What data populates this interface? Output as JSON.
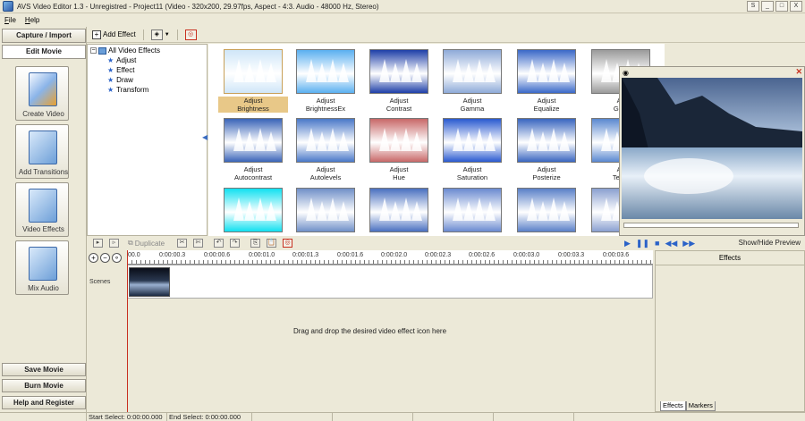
{
  "window": {
    "title": "AVS Video Editor 1.3 - Unregistred - Project11 (Video - 320x200, 29.97fps, Aspect - 4:3. Audio - 48000 Hz, Stereo)",
    "buttons": [
      "S",
      "_",
      "□",
      "X"
    ]
  },
  "menu": [
    {
      "label": "File",
      "accel": "F",
      "rest": "ile"
    },
    {
      "label": "Help",
      "accel": "H",
      "rest": "elp"
    }
  ],
  "left_panel": {
    "capture_import": "Capture / Import",
    "edit_movie": "Edit Movie",
    "tools": [
      {
        "label": "Create Video",
        "icon": "film-folder-icon"
      },
      {
        "label": "Add Transitions",
        "icon": "transitions-icon"
      },
      {
        "label": "Video Effects",
        "icon": "effects-star-icon"
      },
      {
        "label": "Mix Audio",
        "icon": "audio-waveform-icon"
      }
    ],
    "save_movie": "Save Movie",
    "burn_movie": "Burn Movie",
    "help_register": "Help and Register"
  },
  "toolbar": {
    "add_effect": "Add Effect"
  },
  "tree": {
    "root": "All Video Effects",
    "items": [
      "Adjust",
      "Effect",
      "Draw",
      "Transform"
    ]
  },
  "effects": [
    {
      "line1": "Adjust",
      "line2": "Brightness",
      "bg": "#cfe6f8",
      "sel": true
    },
    {
      "line1": "Adjust",
      "line2": "BrightnessEx",
      "bg": "#5ab0f0"
    },
    {
      "line1": "Adjust",
      "line2": "Contrast",
      "bg": "#1e3fa8"
    },
    {
      "line1": "Adjust",
      "line2": "Gamma",
      "bg": "#8eaad8"
    },
    {
      "line1": "Adjust",
      "line2": "Equalize",
      "bg": "#3a68c8"
    },
    {
      "line1": "Ac",
      "line2": "Gray",
      "bg": "#9a9a9a"
    },
    {
      "line1": "Adjust",
      "line2": "Autocontrast",
      "bg": "#3a64b8"
    },
    {
      "line1": "Adjust",
      "line2": "Autolevels",
      "bg": "#4a78c8"
    },
    {
      "line1": "Adjust",
      "line2": "Hue",
      "bg": "#c86868"
    },
    {
      "line1": "Adjust",
      "line2": "Saturation",
      "bg": "#2a5ad0"
    },
    {
      "line1": "Adjust",
      "line2": "Posterize",
      "bg": "#3a66c0"
    },
    {
      "line1": "Ac",
      "line2": "Temp",
      "bg": "#5a88d0"
    },
    {
      "line1": "",
      "line2": "",
      "bg": "#10e0f0"
    },
    {
      "line1": "",
      "line2": "",
      "bg": "#7090c8"
    },
    {
      "line1": "",
      "line2": "",
      "bg": "#4a70c0"
    },
    {
      "line1": "",
      "line2": "",
      "bg": "#6a8ad0"
    },
    {
      "line1": "",
      "line2": "",
      "bg": "#5a80c8"
    },
    {
      "line1": "",
      "line2": "",
      "bg": "#8aa0d0"
    }
  ],
  "preview": {
    "show_hide": "Show/Hide Preview"
  },
  "timeline": {
    "duplicate": "Duplicate",
    "ruler": [
      "00.0",
      "0:00:00.3",
      "0:00:00.6",
      "0:00:01.0",
      "0:00:01.3",
      "0:00:01.6",
      "0:00:02.0",
      "0:00:02.3",
      "0:00:02.6",
      "0:00:03.0",
      "0:00:03.3",
      "0:00:03.6"
    ],
    "scenes_label": "Scenes",
    "drag_hint": "Drag and drop the desired video effect icon here"
  },
  "effects_panel": {
    "title": "Effects",
    "tabs": [
      "Effects",
      "Markers"
    ]
  },
  "status": {
    "start_select": "Start Select: 0:00:00.000",
    "end_select": "End Select: 0:00:00.000"
  }
}
